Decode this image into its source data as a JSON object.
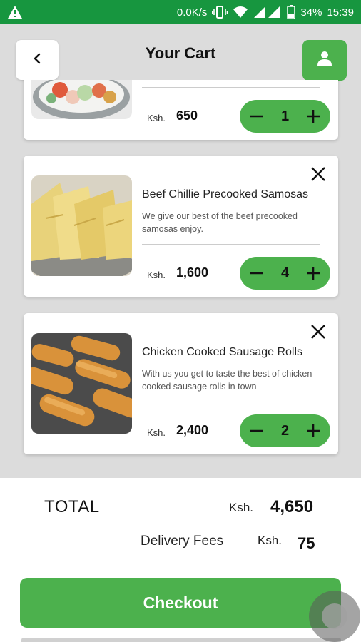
{
  "status_bar": {
    "speed": "0.0K/s",
    "battery": "34%",
    "time": "15:39",
    "warning_icon": "warning-icon",
    "vibrate_icon": "vibrate-icon",
    "wifi_icon": "wifi-icon",
    "signal_icon": "signal-icon",
    "battery_icon": "battery-icon"
  },
  "header": {
    "title": "Your Cart",
    "back_icon": "chevron-left-icon",
    "user_icon": "user-icon"
  },
  "colors": {
    "accent": "#4cb14d",
    "status_bar": "#17963f"
  },
  "cart": {
    "items": [
      {
        "name": "",
        "description": "",
        "currency": "Ksh.",
        "price": "650",
        "quantity": "1"
      },
      {
        "name": "Beef Chillie Precooked Samosas",
        "description": "We give our best of the beef precooked samosas enjoy.",
        "currency": "Ksh.",
        "price": "1,600",
        "quantity": "4"
      },
      {
        "name": "Chicken Cooked Sausage Rolls",
        "description": "With us you get to taste the best of chicken cooked sausage rolls in town",
        "currency": "Ksh.",
        "price": "2,400",
        "quantity": "2"
      }
    ]
  },
  "summary": {
    "total_label": "TOTAL",
    "total_currency": "Ksh.",
    "total_value": "4,650",
    "delivery_label": "Delivery Fees",
    "delivery_currency": "Ksh.",
    "delivery_value": "75",
    "checkout_label": "Checkout"
  }
}
